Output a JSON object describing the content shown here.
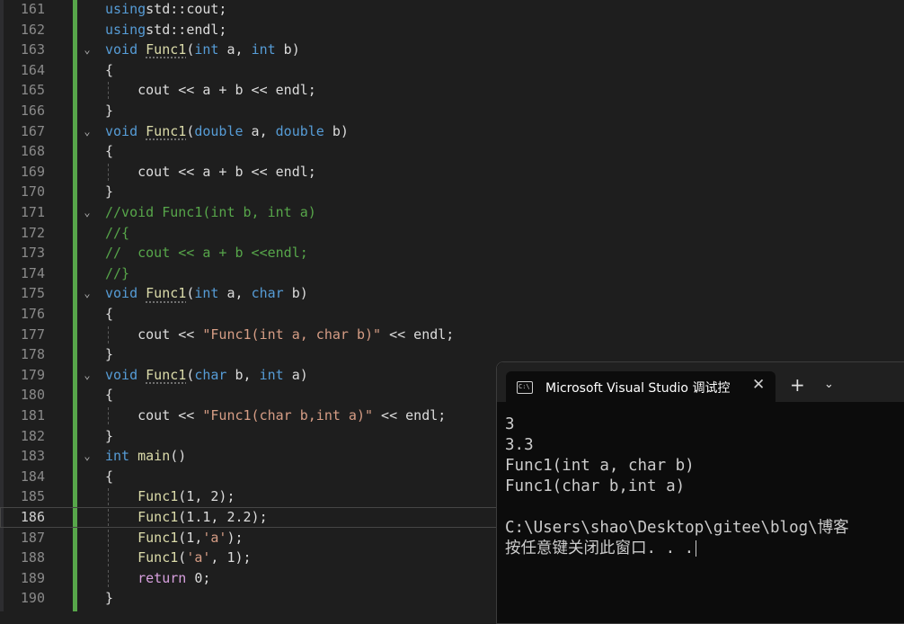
{
  "editor": {
    "current_line": "186",
    "lines": [
      {
        "num": "161",
        "parts": [
          [
            "kw",
            "using"
          ],
          [
            "",
            "std"
          ],
          [
            "",
            "::"
          ],
          [
            "",
            "cout;"
          ]
        ]
      },
      {
        "num": "162",
        "parts": [
          [
            "kw",
            "using"
          ],
          [
            "",
            "std"
          ],
          [
            "",
            "::"
          ],
          [
            "",
            "endl;"
          ]
        ]
      },
      {
        "num": "163",
        "parts": [
          [
            "kw",
            "void "
          ],
          [
            "fn",
            "Func1"
          ],
          [
            "",
            "("
          ],
          [
            "kw",
            "int"
          ],
          [
            "",
            " a, "
          ],
          [
            "kw",
            "int"
          ],
          [
            "",
            " b)"
          ]
        ]
      },
      {
        "num": "164",
        "parts": [
          [
            "",
            "{"
          ]
        ]
      },
      {
        "num": "165",
        "parts": [
          [
            "",
            "    cout << a + b << endl;"
          ]
        ]
      },
      {
        "num": "166",
        "parts": [
          [
            "",
            "}"
          ]
        ]
      },
      {
        "num": "167",
        "parts": [
          [
            "kw",
            "void "
          ],
          [
            "fn",
            "Func1"
          ],
          [
            "",
            "("
          ],
          [
            "kw",
            "double"
          ],
          [
            "",
            " a, "
          ],
          [
            "kw",
            "double"
          ],
          [
            "",
            " b)"
          ]
        ]
      },
      {
        "num": "168",
        "parts": [
          [
            "",
            "{"
          ]
        ]
      },
      {
        "num": "169",
        "parts": [
          [
            "",
            "    cout << a + b << endl;"
          ]
        ]
      },
      {
        "num": "170",
        "parts": [
          [
            "",
            "}"
          ]
        ]
      },
      {
        "num": "171",
        "parts": [
          [
            "cm",
            "//void Func1(int b, int a)"
          ]
        ]
      },
      {
        "num": "172",
        "parts": [
          [
            "cm",
            "//{"
          ]
        ]
      },
      {
        "num": "173",
        "parts": [
          [
            "cm",
            "//  cout << a + b <<endl;"
          ]
        ]
      },
      {
        "num": "174",
        "parts": [
          [
            "cm",
            "//}"
          ]
        ]
      },
      {
        "num": "175",
        "parts": [
          [
            "kw",
            "void "
          ],
          [
            "fn",
            "Func1"
          ],
          [
            "",
            "("
          ],
          [
            "kw",
            "int"
          ],
          [
            "",
            " a, "
          ],
          [
            "kw",
            "char"
          ],
          [
            "",
            " b)"
          ]
        ]
      },
      {
        "num": "176",
        "parts": [
          [
            "",
            "{"
          ]
        ]
      },
      {
        "num": "177",
        "parts": [
          [
            "",
            "    cout << "
          ],
          [
            "str",
            "\"Func1(int a, char b)\""
          ],
          [
            "",
            " << endl;"
          ]
        ]
      },
      {
        "num": "178",
        "parts": [
          [
            "",
            "}"
          ]
        ]
      },
      {
        "num": "179",
        "parts": [
          [
            "kw",
            "void "
          ],
          [
            "fn",
            "Func1"
          ],
          [
            "",
            "("
          ],
          [
            "kw",
            "char"
          ],
          [
            "",
            " b, "
          ],
          [
            "kw",
            "int"
          ],
          [
            "",
            " a)"
          ]
        ]
      },
      {
        "num": "180",
        "parts": [
          [
            "",
            "{"
          ]
        ]
      },
      {
        "num": "181",
        "parts": [
          [
            "",
            "    cout << "
          ],
          [
            "str",
            "\"Func1(char b,int a)\""
          ],
          [
            "",
            " << endl;"
          ]
        ]
      },
      {
        "num": "182",
        "parts": [
          [
            "",
            "}"
          ]
        ]
      },
      {
        "num": "183",
        "parts": [
          [
            "kw",
            "int "
          ],
          [
            "fn",
            "main"
          ],
          [
            "",
            "()"
          ]
        ]
      },
      {
        "num": "184",
        "parts": [
          [
            "",
            "{"
          ]
        ]
      },
      {
        "num": "185",
        "parts": [
          [
            "fn",
            "    Func1"
          ],
          [
            "",
            "(1, 2);"
          ]
        ]
      },
      {
        "num": "186",
        "parts": [
          [
            "fn",
            "    Func1"
          ],
          [
            "",
            "(1.1, 2.2);"
          ]
        ]
      },
      {
        "num": "187",
        "parts": [
          [
            "fn",
            "    Func1"
          ],
          [
            "",
            "(1,"
          ],
          [
            "str",
            "'a'"
          ],
          [
            "",
            ");"
          ]
        ]
      },
      {
        "num": "188",
        "parts": [
          [
            "fn",
            "    Func1"
          ],
          [
            "",
            "("
          ],
          [
            "str",
            "'a'"
          ],
          [
            "",
            ", 1);"
          ]
        ]
      },
      {
        "num": "189",
        "parts": [
          [
            "ret",
            "    return "
          ],
          [
            "",
            "0;"
          ]
        ]
      },
      {
        "num": "190",
        "parts": [
          [
            "",
            "}"
          ]
        ]
      }
    ]
  },
  "console": {
    "tab_icon_text": "C:\\",
    "tab_title": "Microsoft Visual Studio 调试控",
    "close_symbol": "✕",
    "new_tab_symbol": "+",
    "dropdown_symbol": "⌄",
    "output": [
      "3",
      "3.3",
      "Func1(int a, char b)",
      "Func1(char b,int a)",
      "",
      "C:\\Users\\shao\\Desktop\\gitee\\blog\\博客",
      "按任意键关闭此窗口. . ."
    ]
  }
}
